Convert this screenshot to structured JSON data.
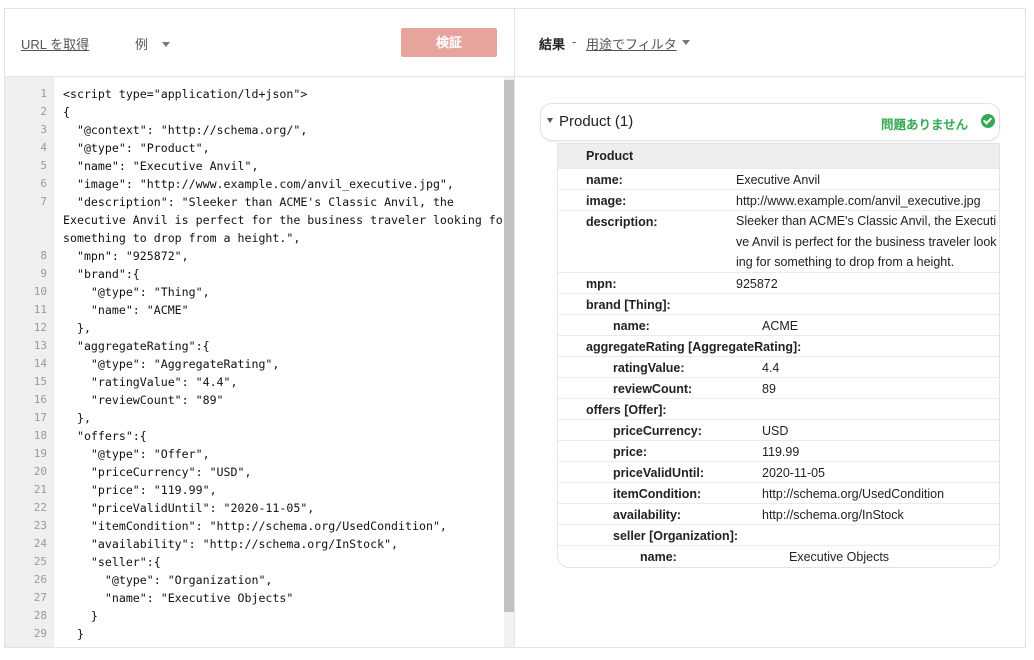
{
  "toolbar": {
    "fetch_url_label": "URL を取得",
    "examples_label": "例",
    "validate_label": "検証"
  },
  "results_header": {
    "title": "結果",
    "separator": "-",
    "filter_label": "用途でフィルタ"
  },
  "editor": {
    "lines": [
      {
        "num": "1",
        "text": "<script type=\"application/ld+json\">"
      },
      {
        "num": "2",
        "text": "{"
      },
      {
        "num": "3",
        "text": "  \"@context\": \"http://schema.org/\","
      },
      {
        "num": "4",
        "text": "  \"@type\": \"Product\","
      },
      {
        "num": "5",
        "text": "  \"name\": \"Executive Anvil\","
      },
      {
        "num": "6",
        "text": "  \"image\": \"http://www.example.com/anvil_executive.jpg\","
      },
      {
        "num": "7",
        "text": "  \"description\": \"Sleeker than ACME's Classic Anvil, the"
      },
      {
        "num": "",
        "text": "Executive Anvil is perfect for the business traveler looking for"
      },
      {
        "num": "",
        "text": "something to drop from a height.\","
      },
      {
        "num": "8",
        "text": "  \"mpn\": \"925872\","
      },
      {
        "num": "9",
        "text": "  \"brand\":{"
      },
      {
        "num": "10",
        "text": "    \"@type\": \"Thing\","
      },
      {
        "num": "11",
        "text": "    \"name\": \"ACME\""
      },
      {
        "num": "12",
        "text": "  },"
      },
      {
        "num": "13",
        "text": "  \"aggregateRating\":{"
      },
      {
        "num": "14",
        "text": "    \"@type\": \"AggregateRating\","
      },
      {
        "num": "15",
        "text": "    \"ratingValue\": \"4.4\","
      },
      {
        "num": "16",
        "text": "    \"reviewCount\": \"89\""
      },
      {
        "num": "17",
        "text": "  },"
      },
      {
        "num": "18",
        "text": "  \"offers\":{"
      },
      {
        "num": "19",
        "text": "    \"@type\": \"Offer\","
      },
      {
        "num": "20",
        "text": "    \"priceCurrency\": \"USD\","
      },
      {
        "num": "21",
        "text": "    \"price\": \"119.99\","
      },
      {
        "num": "22",
        "text": "    \"priceValidUntil\": \"2020-11-05\","
      },
      {
        "num": "23",
        "text": "    \"itemCondition\": \"http://schema.org/UsedCondition\","
      },
      {
        "num": "24",
        "text": "    \"availability\": \"http://schema.org/InStock\","
      },
      {
        "num": "25",
        "text": "    \"seller\":{"
      },
      {
        "num": "26",
        "text": "      \"@type\": \"Organization\","
      },
      {
        "num": "27",
        "text": "      \"name\": \"Executive Objects\""
      },
      {
        "num": "28",
        "text": "    }"
      },
      {
        "num": "29",
        "text": "  }"
      }
    ]
  },
  "result_card": {
    "title": "Product (1)",
    "status": "問題ありません",
    "status_color": "#34a853",
    "table_heading": "Product",
    "rows": [
      {
        "key": "name:",
        "value": "Executive Anvil",
        "level": 0
      },
      {
        "key": "image:",
        "value": "http://www.example.com/anvil_executive.jpg",
        "level": 0
      },
      {
        "key": "description:",
        "value": "Sleeker than ACME's Classic Anvil, the Executive Anvil is perfect for the business traveler looking for something to drop from a height.",
        "level": 0,
        "wrap": true
      },
      {
        "key": "mpn:",
        "value": "925872",
        "level": 0
      },
      {
        "key": "brand [Thing]:",
        "value": "",
        "level": 0
      },
      {
        "key": "name:",
        "value": "ACME",
        "level": 1
      },
      {
        "key": "aggregateRating [AggregateRating]:",
        "value": "",
        "level": 0
      },
      {
        "key": "ratingValue:",
        "value": "4.4",
        "level": 1
      },
      {
        "key": "reviewCount:",
        "value": "89",
        "level": 1
      },
      {
        "key": "offers [Offer]:",
        "value": "",
        "level": 0
      },
      {
        "key": "priceCurrency:",
        "value": "USD",
        "level": 1
      },
      {
        "key": "price:",
        "value": "119.99",
        "level": 1
      },
      {
        "key": "priceValidUntil:",
        "value": "2020-11-05",
        "level": 1
      },
      {
        "key": "itemCondition:",
        "value": "http://schema.org/UsedCondition",
        "level": 1
      },
      {
        "key": "availability:",
        "value": "http://schema.org/InStock",
        "level": 1
      },
      {
        "key": "seller [Organization]:",
        "value": "",
        "level": 1
      },
      {
        "key": "name:",
        "value": "Executive Objects",
        "level": 2
      }
    ]
  }
}
